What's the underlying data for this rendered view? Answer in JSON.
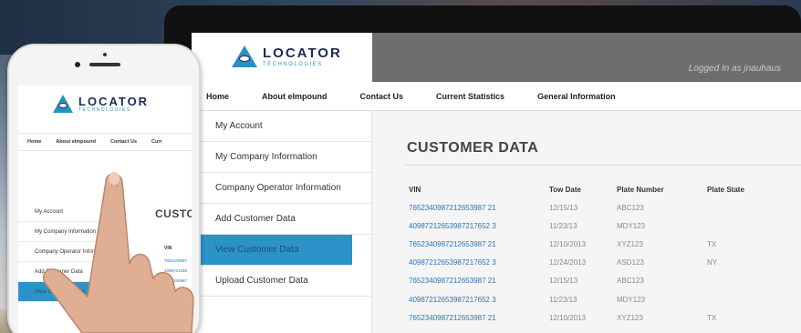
{
  "laptop": {
    "logo": {
      "name": "LOCATOR",
      "sub": "TECHNOLOGIES"
    },
    "logged_in": "Logged In as jnauhaus",
    "nav": [
      "Home",
      "About eImpound",
      "Contact Us",
      "Current Statistics",
      "General Information"
    ],
    "sidebar": [
      {
        "label": "My Account",
        "active": false
      },
      {
        "label": "My Company Information",
        "active": false
      },
      {
        "label": "Company Operator Information",
        "active": false
      },
      {
        "label": "Add Customer Data",
        "active": false
      },
      {
        "label": "View Customer Data",
        "active": true
      },
      {
        "label": "Upload Customer Data",
        "active": false
      }
    ],
    "main_title": "CUSTOMER DATA",
    "table": {
      "headers": [
        "VIN",
        "Tow Date",
        "Plate Number",
        "Plate State"
      ],
      "rows": [
        [
          "7652340987212653987 21",
          "12/15/13",
          "ABC123",
          ""
        ],
        [
          "40987212653987217652 3",
          "11/23/13",
          "MDY123",
          ""
        ],
        [
          "7652340987212653987 21",
          "12/10/2013",
          "XYZ123",
          "TX"
        ],
        [
          "40987212653987217652 3",
          "12/24/2013",
          "ASD123",
          "NY"
        ],
        [
          "7652340987212653987 21",
          "12/15/13",
          "ABC123",
          ""
        ],
        [
          "40987212653987217652 3",
          "11/23/13",
          "MDY123",
          ""
        ],
        [
          "7652340987212653987 21",
          "12/10/2013",
          "XYZ123",
          "TX"
        ]
      ]
    }
  },
  "phone": {
    "logo": {
      "name": "LOCATOR",
      "sub": "TECHNOLOGIES"
    },
    "nav": [
      "Home",
      "About eImpound",
      "Contact Us",
      "Curr"
    ],
    "sidebar": [
      {
        "label": "My Account",
        "active": false
      },
      {
        "label": "My Company Information",
        "active": false
      },
      {
        "label": "Company Operator Information",
        "active": false
      },
      {
        "label": "Add Customer Data",
        "active": false
      },
      {
        "label": "View Customer Data",
        "active": true
      }
    ],
    "main_title": "CUSTO",
    "vin_head": "VIN",
    "vins": [
      "7652340987",
      "4098721265",
      "7652340987",
      "4098721265",
      "7652340987",
      "4098721265",
      "7652340987"
    ]
  },
  "colors": {
    "accent": "#2c93c9",
    "brand_dark": "#1b2a55",
    "link": "#2a73b7"
  }
}
